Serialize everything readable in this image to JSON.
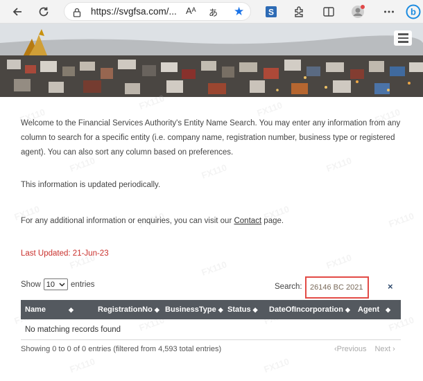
{
  "browser": {
    "url": "https://svgfsa.com/...",
    "read_aloud": "Aᴬ",
    "translate_glyph": "あ"
  },
  "page": {
    "intro": "Welcome to the Financial Services Authority's Entity Name Search. You may enter any information from any column to search for a specific entity (i.e. company name, registration number, business type or registered agent). You can also sort any column based on preferences.",
    "updated_info": "This information is updated periodically.",
    "contact_prefix": "For any additional information or enquiries, you can visit our ",
    "contact_link": "Contact",
    "contact_suffix": " page.",
    "last_updated": "Last Updated:  21-Jun-23"
  },
  "table_controls": {
    "show_label": "Show",
    "entries_value": "10",
    "entries_label": "entries",
    "search_label": "Search:",
    "search_value": "26146 BC 2021",
    "clear_symbol": "×"
  },
  "table": {
    "columns": [
      "Name",
      "RegistrationNo",
      "BusinessType",
      "Status",
      "DateOfIncorporation",
      "Agent"
    ],
    "empty_message": "No matching records found",
    "summary": "Showing 0 to 0 of 0 entries (filtered from 4,593 total entries)",
    "prev": "Previous",
    "next": "Next"
  },
  "colors": {
    "accent_red": "#c9302c",
    "header_bg": "#54595f",
    "highlight_border": "#e24a45",
    "star_blue": "#1a73e8"
  },
  "icons": [
    "back-arrow-icon",
    "refresh-icon",
    "lock-icon",
    "read-aloud-icon",
    "translate-icon",
    "star-icon",
    "s-extension-icon",
    "puzzle-extension-icon",
    "split-screen-icon",
    "profile-icon",
    "more-icon",
    "bing-icon",
    "hamburger-menu-icon"
  ]
}
